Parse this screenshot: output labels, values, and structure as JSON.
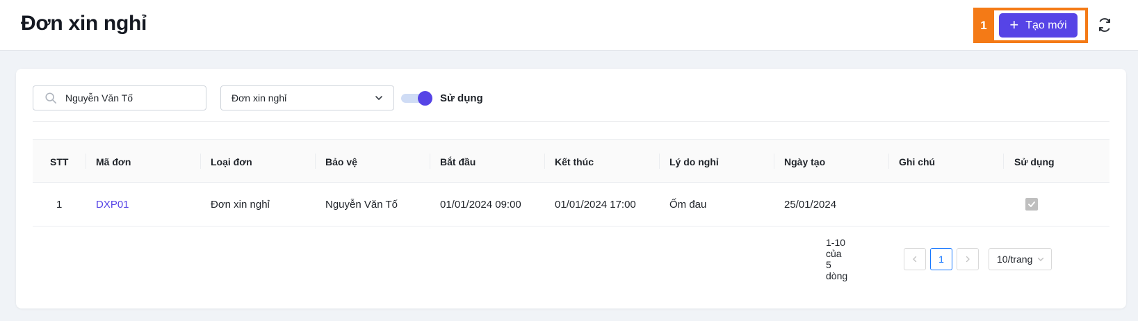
{
  "header": {
    "title": "Đơn xin nghỉ",
    "highlight_badge": "1",
    "create_label": "Tạo mới"
  },
  "filters": {
    "search_value": "Nguyễn Văn Tố",
    "type_select": "Đơn xin nghỉ",
    "toggle_label": "Sử dụng",
    "toggle_on": true
  },
  "table": {
    "columns": [
      "STT",
      "Mã đơn",
      "Loại đơn",
      "Bảo vệ",
      "Bắt đầu",
      "Kết thúc",
      "Lý do nghỉ",
      "Ngày tạo",
      "Ghi chú",
      "Sử dụng"
    ],
    "rows": [
      {
        "stt": "1",
        "code": "DXP01",
        "type": "Đơn xin nghỉ",
        "guard": "Nguyễn Văn Tố",
        "start": "01/01/2024 09:00",
        "end": "01/01/2024 17:00",
        "reason": "Ốm đau",
        "created": "25/01/2024",
        "note": "",
        "active": true
      }
    ]
  },
  "pagination": {
    "total_text": "1-10 của 5 dòng",
    "current_page": "1",
    "page_size": "10/trang"
  },
  "colors": {
    "accent": "#5644e6",
    "highlight": "#f47a16",
    "pagination_active": "#1677ff"
  }
}
